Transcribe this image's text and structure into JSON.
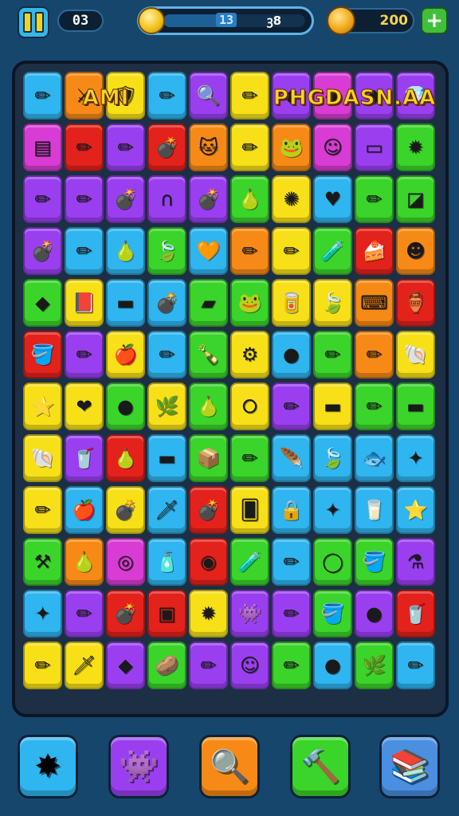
{
  "hud": {
    "moves": "03",
    "level": "13",
    "score": "ꝫ8",
    "coins": "200",
    "icons": {
      "pause": "pause-icon",
      "progress_coin": "coin-icon",
      "wallet_coin": "coin-icon",
      "add": "plus-icon"
    },
    "plus": "+"
  },
  "banners": [
    {
      "text": "AMI",
      "col_start": 1,
      "col_span": 2
    },
    {
      "text": "PHGDASN.AA",
      "col_start": 6,
      "col_span": 4
    }
  ],
  "colors": {
    "Y": "#f7e017",
    "O": "#f78a16",
    "R": "#e3221c",
    "P": "#9a3ff0",
    "B": "#2fb5ef",
    "G": "#3bd42a",
    "A": "#2ad8c2",
    "M": "#d83cd4",
    "D": "#4a8fe0"
  },
  "rows": [
    [
      [
        "B",
        "pencil-icon",
        "✏"
      ],
      [
        "O",
        "sword-icon",
        "⚔"
      ],
      [
        "Y",
        "shield-icon",
        "🛡"
      ],
      [
        "B",
        "pencil-icon",
        "✏"
      ],
      [
        "P",
        "magnifier-icon",
        "🔍"
      ],
      [
        "Y",
        "pencil-icon",
        "✏"
      ],
      [
        "P",
        "gem-icon",
        "◆"
      ],
      [
        "M",
        "gem-icon",
        "◆"
      ],
      [
        "P",
        "gem-icon",
        "◆"
      ],
      [
        "P",
        "gem-icon",
        "💎"
      ]
    ],
    [
      [
        "M",
        "book-icon",
        "▤"
      ],
      [
        "R",
        "pencil-icon",
        "✏"
      ],
      [
        "P",
        "pencil-icon",
        "✏"
      ],
      [
        "R",
        "bomb-icon",
        "💣"
      ],
      [
        "O",
        "cat-face-icon",
        "🐱"
      ],
      [
        "Y",
        "pencil-icon",
        "✏"
      ],
      [
        "O",
        "frog-icon",
        "🐸"
      ],
      [
        "M",
        "face-icon",
        "☺"
      ],
      [
        "P",
        "book-icon",
        "▭"
      ],
      [
        "G",
        "star-burst-icon",
        "✹"
      ]
    ],
    [
      [
        "P",
        "pencil-icon",
        "✏"
      ],
      [
        "P",
        "pencil-icon",
        "✏"
      ],
      [
        "P",
        "bomb-icon",
        "💣"
      ],
      [
        "P",
        "magnet-icon",
        "∩"
      ],
      [
        "P",
        "bomb-icon",
        "💣"
      ],
      [
        "G",
        "pear-icon",
        "🍐"
      ],
      [
        "Y",
        "sun-icon",
        "✺"
      ],
      [
        "B",
        "heart-icon",
        "♥"
      ],
      [
        "G",
        "pencil-icon",
        "✏"
      ],
      [
        "G",
        "tablet-icon",
        "◪"
      ]
    ],
    [
      [
        "P",
        "bomb-icon",
        "💣"
      ],
      [
        "B",
        "pencil-icon",
        "✏"
      ],
      [
        "B",
        "pear-icon",
        "🍐"
      ],
      [
        "G",
        "leaf-icon",
        "🍃"
      ],
      [
        "B",
        "heart-icon",
        "🧡"
      ],
      [
        "O",
        "pencil-icon",
        "✏"
      ],
      [
        "Y",
        "pencil-icon",
        "✏"
      ],
      [
        "G",
        "bottle-icon",
        "🧪"
      ],
      [
        "R",
        "cake-icon",
        "🍰"
      ],
      [
        "O",
        "face-icon",
        "☻"
      ]
    ],
    [
      [
        "G",
        "crystal-icon",
        "◆"
      ],
      [
        "Y",
        "book-icon",
        "📕"
      ],
      [
        "B",
        "bandage-icon",
        "▬"
      ],
      [
        "B",
        "bomb-icon",
        "💣"
      ],
      [
        "G",
        "eraser-icon",
        "▰"
      ],
      [
        "G",
        "frog-icon",
        "🐸"
      ],
      [
        "Y",
        "can-icon",
        "🥫"
      ],
      [
        "Y",
        "leaf-icon",
        "🍃"
      ],
      [
        "O",
        "keyboard-icon",
        "⌨"
      ],
      [
        "R",
        "jar-icon",
        "🏺"
      ]
    ],
    [
      [
        "R",
        "bucket-icon",
        "🪣"
      ],
      [
        "P",
        "pencil-icon",
        "✏"
      ],
      [
        "Y",
        "apple-icon",
        "🍎"
      ],
      [
        "B",
        "pencil-icon",
        "✏"
      ],
      [
        "G",
        "bottle-icon",
        "🍾"
      ],
      [
        "Y",
        "gear-icon",
        "⚙"
      ],
      [
        "B",
        "orb-icon",
        "●"
      ],
      [
        "G",
        "pencil-icon",
        "✏"
      ],
      [
        "O",
        "pencil-icon",
        "✏"
      ],
      [
        "Y",
        "shell-icon",
        "🐚"
      ]
    ],
    [
      [
        "Y",
        "star-icon",
        "⭐"
      ],
      [
        "Y",
        "heart-icon",
        "❤"
      ],
      [
        "G",
        "orb-icon",
        "●"
      ],
      [
        "Y",
        "leaf-icon",
        "🌿"
      ],
      [
        "G",
        "pear-icon",
        "🍐"
      ],
      [
        "Y",
        "ring-icon",
        "⭘"
      ],
      [
        "P",
        "pencil-icon",
        "✏"
      ],
      [
        "Y",
        "block-icon",
        "▬"
      ],
      [
        "G",
        "pencil-icon",
        "✏"
      ],
      [
        "G",
        "bottle-icon",
        "▬"
      ]
    ],
    [
      [
        "Y",
        "shell-icon",
        "🐚"
      ],
      [
        "P",
        "cup-icon",
        "🥤"
      ],
      [
        "R",
        "pear-icon",
        "🍐"
      ],
      [
        "B",
        "book-icon",
        "▬"
      ],
      [
        "G",
        "box-icon",
        "📦"
      ],
      [
        "G",
        "pencil-icon",
        "✏"
      ],
      [
        "B",
        "feather-icon",
        "🪶"
      ],
      [
        "B",
        "leaf-icon",
        "🍃"
      ],
      [
        "B",
        "fish-icon",
        "🐟"
      ],
      [
        "B",
        "star-icon",
        "✦"
      ]
    ],
    [
      [
        "Y",
        "pencil-icon",
        "✏"
      ],
      [
        "B",
        "apple-icon",
        "🍎"
      ],
      [
        "Y",
        "bomb-icon",
        "💣"
      ],
      [
        "B",
        "sword-icon",
        "🗡"
      ],
      [
        "R",
        "bomb-icon",
        "💣"
      ],
      [
        "Y",
        "card-icon",
        "🂠"
      ],
      [
        "B",
        "lock-icon",
        "🔒"
      ],
      [
        "B",
        "star-icon",
        "✦"
      ],
      [
        "B",
        "jar-icon",
        "🥛"
      ],
      [
        "B",
        "star-icon",
        "⭐"
      ]
    ],
    [
      [
        "G",
        "tools-icon",
        "⚒"
      ],
      [
        "O",
        "pear-icon",
        "🍐"
      ],
      [
        "M",
        "ring-icon",
        "◎"
      ],
      [
        "B",
        "bottle-icon",
        "🧴"
      ],
      [
        "R",
        "disc-icon",
        "◉"
      ],
      [
        "G",
        "bottle-icon",
        "🧪"
      ],
      [
        "B",
        "pencil-icon",
        "✏"
      ],
      [
        "G",
        "ring-icon",
        "◯"
      ],
      [
        "G",
        "bucket-icon",
        "🪣"
      ],
      [
        "P",
        "flask-icon",
        "⚗"
      ]
    ],
    [
      [
        "B",
        "star-icon",
        "✦"
      ],
      [
        "P",
        "pencil-icon",
        "✏"
      ],
      [
        "R",
        "bomb-icon",
        "💣"
      ],
      [
        "R",
        "box-icon",
        "▣"
      ],
      [
        "Y",
        "sun-icon",
        "✹"
      ],
      [
        "P",
        "monster-icon",
        "👾"
      ],
      [
        "P",
        "pencil-icon",
        "✏"
      ],
      [
        "G",
        "bucket-icon",
        "🪣"
      ],
      [
        "P",
        "orb-icon",
        "●"
      ],
      [
        "R",
        "cup-icon",
        "🥤"
      ]
    ],
    [
      [
        "Y",
        "pencil-icon",
        "✏"
      ],
      [
        "Y",
        "sword-icon",
        "🗡"
      ],
      [
        "P",
        "gem-icon",
        "◆"
      ],
      [
        "G",
        "pear-icon",
        "🥔"
      ],
      [
        "P",
        "pencil-icon",
        "✏"
      ],
      [
        "P",
        "face-icon",
        "☺"
      ],
      [
        "G",
        "pencil-icon",
        "✏"
      ],
      [
        "B",
        "orb-icon",
        "●"
      ],
      [
        "G",
        "leaf-icon",
        "🌿"
      ],
      [
        "B",
        "pencil-icon",
        "✏"
      ]
    ]
  ],
  "bottom_buttons": [
    {
      "name": "star-burst-button",
      "icon": "star-burst-icon",
      "glyph": "✸",
      "color": "B"
    },
    {
      "name": "monster-button",
      "icon": "monster-icon",
      "glyph": "👾",
      "color": "P"
    },
    {
      "name": "search-button",
      "icon": "magnifier-icon",
      "glyph": "🔍",
      "color": "O"
    },
    {
      "name": "hammer-button",
      "icon": "hammer-icon",
      "glyph": "🔨",
      "color": "G"
    },
    {
      "name": "shelf-button",
      "icon": "bookshelf-icon",
      "glyph": "📚",
      "color": "D"
    }
  ]
}
